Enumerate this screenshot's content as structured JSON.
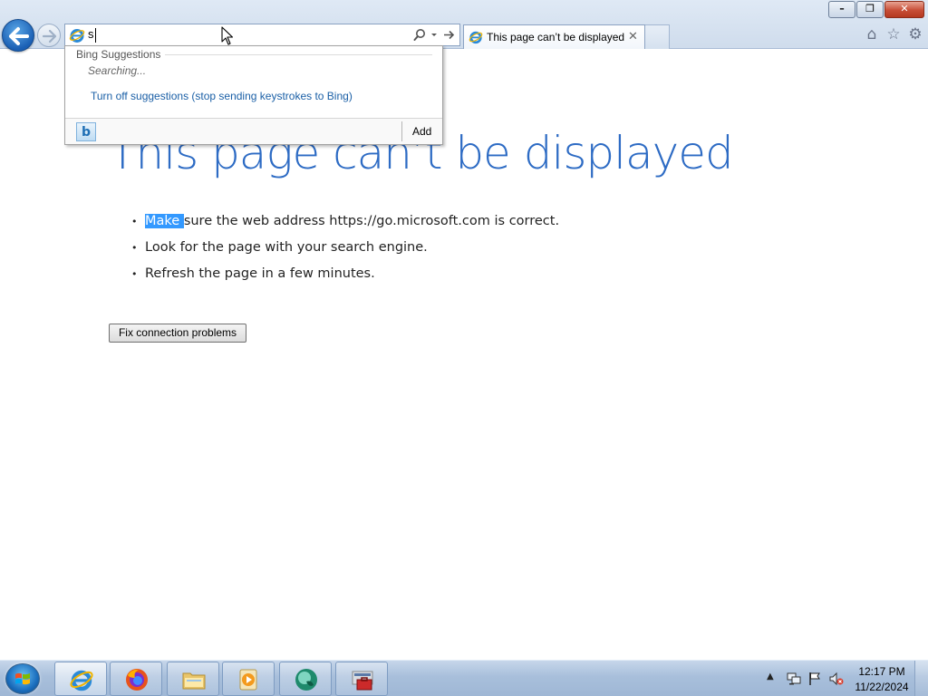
{
  "browser": {
    "address_value": "s",
    "tab_title": "This page can’t be displayed",
    "tab_close_glyph": "✕",
    "window_buttons": {
      "minimize": "–",
      "maximize": "❐",
      "close": "✕"
    },
    "toolbar_icons": [
      "home-icon",
      "favorites-star-icon",
      "tools-gear-icon"
    ]
  },
  "suggestions": {
    "title": "Bing Suggestions",
    "status": "Searching...",
    "turn_off_link": "Turn off suggestions (stop sending keystrokes to Bing)",
    "provider_icon": "b",
    "add_label": "Add"
  },
  "page": {
    "title": "This page can’t be displayed",
    "tips": [
      {
        "selected": "Make ",
        "rest": "sure the web address https://go.microsoft.com is correct."
      },
      {
        "selected": "",
        "rest": "Look for the page with your search engine."
      },
      {
        "selected": "",
        "rest": "Refresh the page in a few minutes."
      }
    ],
    "bullet": "•",
    "fix_button": "Fix connection problems"
  },
  "taskbar": {
    "items": [
      "internet-explorer",
      "firefox",
      "file-explorer",
      "media-player",
      "app-green-circle",
      "toolbox-app"
    ],
    "active_item": "internet-explorer",
    "tray": {
      "time": "12:17 PM",
      "date": "11/22/2024",
      "show_hidden_glyph": "▲"
    }
  },
  "colors": {
    "title_blue": "#2d6bc4",
    "link_blue": "#1a5fa6",
    "selection": "#3399ff",
    "close_red": "#c74d36"
  }
}
